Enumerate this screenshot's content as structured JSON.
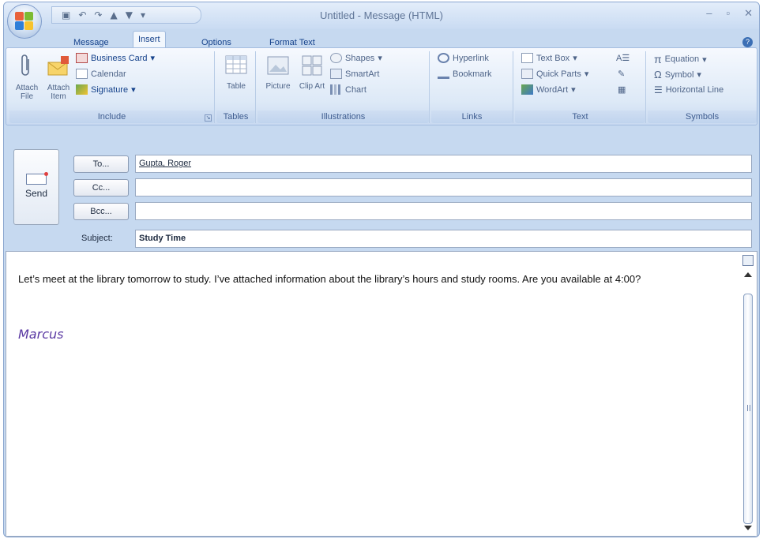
{
  "window": {
    "title": "Untitled - Message (HTML)"
  },
  "tabs": [
    "Message",
    "Insert",
    "Options",
    "Format Text"
  ],
  "ribbon": {
    "include": {
      "label": "Include",
      "attach_file": "Attach File",
      "attach_item": "Attach Item",
      "business_card": "Business Card",
      "calendar": "Calendar",
      "signature": "Signature"
    },
    "tables": {
      "label": "Tables",
      "table": "Table"
    },
    "illustrations": {
      "label": "Illustrations",
      "picture": "Picture",
      "clip_art": "Clip Art",
      "shapes": "Shapes",
      "smartart": "SmartArt",
      "chart": "Chart"
    },
    "links": {
      "label": "Links",
      "hyperlink": "Hyperlink",
      "bookmark": "Bookmark"
    },
    "text": {
      "label": "Text",
      "text_box": "Text Box",
      "quick_parts": "Quick Parts",
      "wordart": "WordArt"
    },
    "symbols": {
      "label": "Symbols",
      "equation": "Equation",
      "symbol": "Symbol",
      "horizontal_line": "Horizontal Line"
    }
  },
  "compose": {
    "send": "Send",
    "to_button": "To...",
    "cc_button": "Cc...",
    "bcc_button": "Bcc...",
    "to_value": "Gupta, Roger",
    "cc_value": "",
    "bcc_value": "",
    "subject_label": "Subject:",
    "subject_value": "Study Time"
  },
  "body": {
    "text": "Let’s meet at the library tomorrow to study. I’ve attached information about the library’s hours and study rooms. Are you available at 4:00?",
    "signature": "Marcus"
  }
}
